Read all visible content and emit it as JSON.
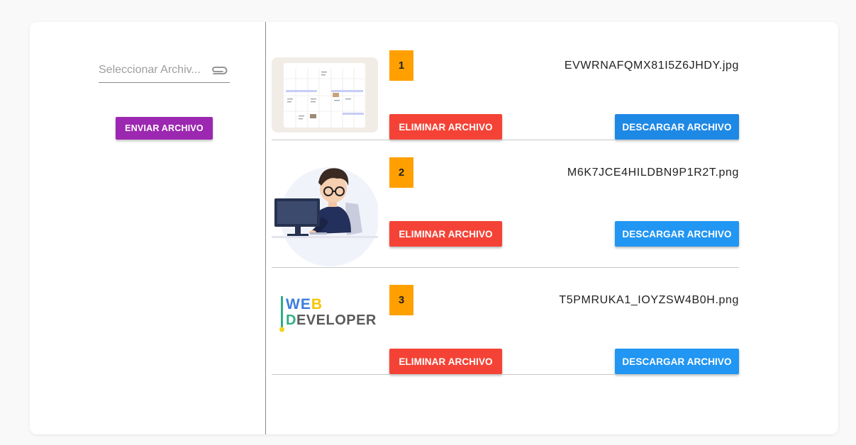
{
  "upload": {
    "placeholder": "Seleccionar Archiv...",
    "attach_icon": "paperclip-icon",
    "send_label": "ENVIAR ARCHIVO"
  },
  "files": [
    {
      "index": "1",
      "name": "EVWRNAFQMX81I5Z6JHDY.jpg",
      "thumbnail": "calendar-screenshot",
      "delete_label": "ELIMINAR ARCHIVO",
      "download_label": "DESCARGAR ARCHIVO"
    },
    {
      "index": "2",
      "name": "M6K7JCE4HILDBN9P1R2T.png",
      "thumbnail": "developer-illustration",
      "delete_label": "ELIMINAR ARCHIVO",
      "download_label": "DESCARGAR ARCHIVO"
    },
    {
      "index": "3",
      "name": "T5PMRUKA1_IOYZSW4B0H.png",
      "thumbnail": "web-developer-logo",
      "delete_label": "ELIMINAR ARCHIVO",
      "download_label": "DESCARGAR ARCHIVO",
      "logo_text": {
        "line1_a": "WE",
        "line1_b": "B",
        "line2_a": "D",
        "line2_b": "EVELOPER"
      }
    }
  ],
  "colors": {
    "send": "#9c27b0",
    "delete": "#f44336",
    "download": "#2196f3",
    "badge": "#ffa000"
  }
}
